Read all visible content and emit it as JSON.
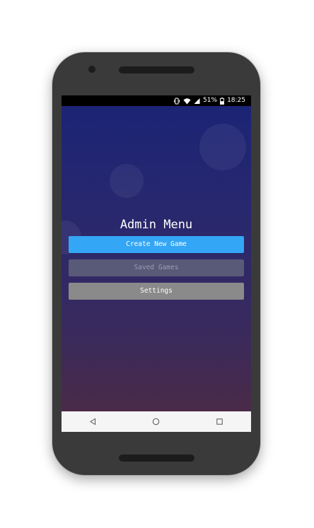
{
  "status_bar": {
    "battery": "51%",
    "time": "18:25"
  },
  "icons": {
    "vibrate": "vibrate-icon",
    "wifi": "wifi-icon",
    "signal": "signal-icon",
    "battery": "battery-icon"
  },
  "main": {
    "title": "Admin Menu",
    "buttons": [
      {
        "label": "Create New Game"
      },
      {
        "label": "Saved Games"
      },
      {
        "label": "Settings"
      }
    ]
  },
  "nav_bar": {
    "items": [
      "back-icon",
      "home-icon",
      "recents-icon"
    ]
  },
  "colors": {
    "primary_button": "#33a6f5",
    "disabled_button": "#595978",
    "secondary_button": "#8a8a8a"
  }
}
